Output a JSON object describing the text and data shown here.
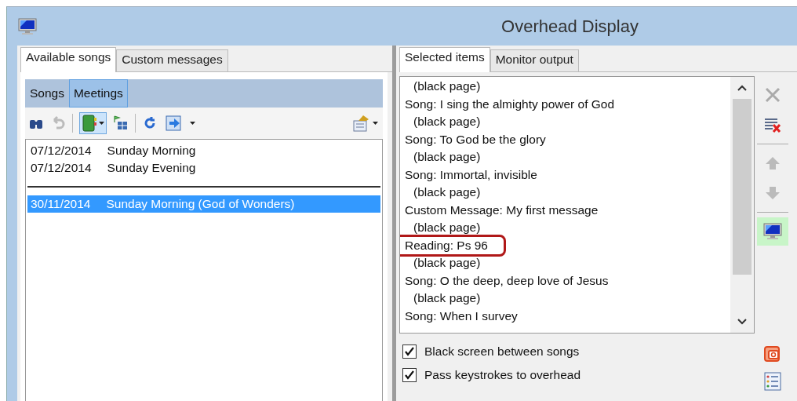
{
  "window": {
    "title": "Overhead Display"
  },
  "left_tabs": [
    {
      "label": "Available songs",
      "selected": true
    },
    {
      "label": "Custom messages",
      "selected": false
    }
  ],
  "sub_tabs": [
    {
      "label": "Songs",
      "selected": false
    },
    {
      "label": "Meetings",
      "selected": true
    }
  ],
  "meetings": [
    {
      "kind": "meeting",
      "date": "07/12/2014",
      "name": "Sunday Morning",
      "selected": false
    },
    {
      "kind": "meeting",
      "date": "07/12/2014",
      "name": "Sunday Evening",
      "selected": false
    },
    {
      "kind": "separator"
    },
    {
      "kind": "meeting",
      "date": "30/11/2014",
      "name": "Sunday Morning (God of Wonders)",
      "selected": true
    }
  ],
  "right_tabs": [
    {
      "label": "Selected items",
      "selected": true
    },
    {
      "label": "Monitor output",
      "selected": false
    }
  ],
  "selected_items": [
    {
      "kind": "blank",
      "text": "(black page)",
      "highlighted": false
    },
    {
      "kind": "item",
      "text": "Song: I sing the almighty power of God",
      "highlighted": false
    },
    {
      "kind": "blank",
      "text": "(black page)",
      "highlighted": false
    },
    {
      "kind": "item",
      "text": "Song: To God be the glory",
      "highlighted": false
    },
    {
      "kind": "blank",
      "text": "(black page)",
      "highlighted": false
    },
    {
      "kind": "item",
      "text": "Song: Immortal, invisible",
      "highlighted": false
    },
    {
      "kind": "blank",
      "text": "(black page)",
      "highlighted": false
    },
    {
      "kind": "item",
      "text": "Custom Message: My first message",
      "highlighted": false
    },
    {
      "kind": "blank",
      "text": "(black page)",
      "highlighted": false
    },
    {
      "kind": "item",
      "text": "Reading: Ps 96",
      "highlighted": true
    },
    {
      "kind": "blank",
      "text": "(black page)",
      "highlighted": false
    },
    {
      "kind": "item",
      "text": "Song: O the deep, deep love of Jesus",
      "highlighted": false
    },
    {
      "kind": "blank",
      "text": "(black page)",
      "highlighted": false
    },
    {
      "kind": "item",
      "text": "Song: When I survey",
      "highlighted": false
    }
  ],
  "options": [
    {
      "label": "Black screen between songs",
      "checked": true
    },
    {
      "label": "Pass keystrokes to overhead",
      "checked": true
    }
  ],
  "side_buttons": [
    {
      "kind": "delete",
      "disabled": true
    },
    {
      "kind": "clear",
      "disabled": false
    },
    {
      "kind": "up",
      "disabled": true
    },
    {
      "kind": "down",
      "disabled": true
    },
    {
      "kind": "monitor",
      "active": true,
      "disabled": false
    }
  ]
}
